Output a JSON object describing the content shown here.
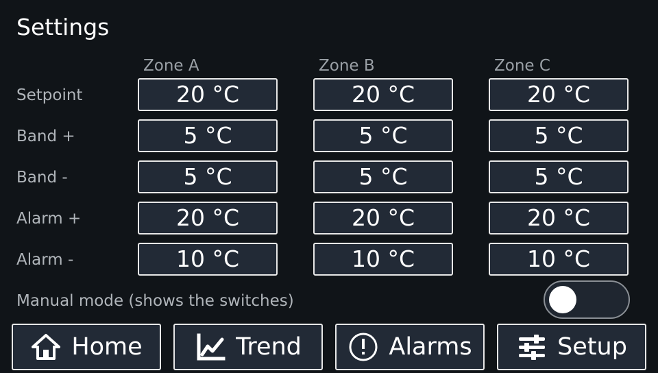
{
  "title": "Settings",
  "zones": [
    "Zone A",
    "Zone B",
    "Zone C"
  ],
  "rows": [
    {
      "label": "Setpoint",
      "values": [
        "20 °C",
        "20 °C",
        "20 °C"
      ]
    },
    {
      "label": "Band +",
      "values": [
        "5 °C",
        "5 °C",
        "5 °C"
      ]
    },
    {
      "label": "Band -",
      "values": [
        "5 °C",
        "5 °C",
        "5 °C"
      ]
    },
    {
      "label": "Alarm +",
      "values": [
        "20 °C",
        "20 °C",
        "20 °C"
      ]
    },
    {
      "label": "Alarm -",
      "values": [
        "10 °C",
        "10 °C",
        "10 °C"
      ]
    }
  ],
  "manual_mode": {
    "label": "Manual mode (shows the switches)",
    "enabled": false
  },
  "nav": [
    {
      "label": "Home",
      "icon": "home-icon"
    },
    {
      "label": "Trend",
      "icon": "trend-icon"
    },
    {
      "label": "Alarms",
      "icon": "alarm-icon"
    },
    {
      "label": "Setup",
      "icon": "setup-icon"
    }
  ],
  "colors": {
    "background": "#101418",
    "box_fill": "#222a36",
    "box_border": "#e8e8e8",
    "label_text": "#b0b5ba"
  }
}
